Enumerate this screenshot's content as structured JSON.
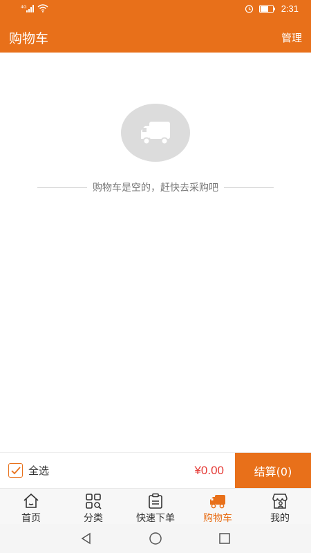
{
  "status_bar": {
    "time": "2:31",
    "network": "4G",
    "icons": [
      "signal-icon",
      "wifi-icon",
      "alarm-icon",
      "battery-icon"
    ]
  },
  "header": {
    "title": "购物车",
    "manage_label": "管理"
  },
  "empty_state": {
    "icon": "truck-icon",
    "message": "购物车是空的，赶快去采购吧"
  },
  "cart_bar": {
    "select_all_label": "全选",
    "select_all_checked": true,
    "total": "¥0.00",
    "checkout_label": "结算(0)"
  },
  "tabs": [
    {
      "label": "首页",
      "icon": "home-icon",
      "active": false
    },
    {
      "label": "分类",
      "icon": "category-icon",
      "active": false
    },
    {
      "label": "快速下单",
      "icon": "clipboard-icon",
      "active": false
    },
    {
      "label": "购物车",
      "icon": "truck-icon",
      "active": true
    },
    {
      "label": "我的",
      "icon": "store-user-icon",
      "active": false
    }
  ],
  "system_nav": [
    "back-icon",
    "home-circle-icon",
    "recents-icon"
  ],
  "colors": {
    "accent": "#e8701a",
    "price": "#e53935",
    "empty_icon_bg": "#dcdcdc"
  }
}
